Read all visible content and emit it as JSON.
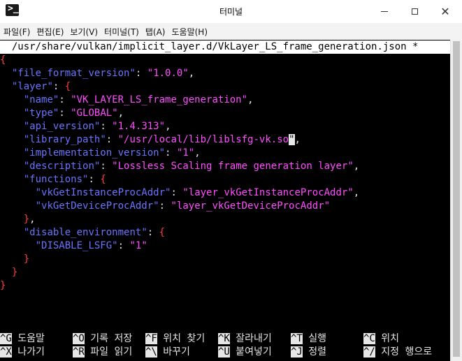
{
  "window": {
    "title": "터미널",
    "prompt_glyph": ">_",
    "close_glyph": "✕"
  },
  "menu": [
    "파일(F)",
    "편집(E)",
    "보기(V)",
    "터미널(T)",
    "탭(A)",
    "도움말(H)"
  ],
  "editor": {
    "header": "  /usr/share/vulkan/implicit_layer.d/VkLayer_LS_frame_generation.json *",
    "cursor_char": "\""
  },
  "json": {
    "open_brace": "{",
    "close_brace": "}",
    "file_format_version_key": "file_format_version",
    "file_format_version_value": "1.0.0",
    "layer_key": "layer",
    "name_key": "name",
    "name_value": "VK_LAYER_LS_frame_generation",
    "type_key": "type",
    "type_value": "GLOBAL",
    "api_version_key": "api_version",
    "api_version_value": "1.4.313",
    "library_path_key": "library_path",
    "library_path_value": "/usr/local/lib/liblsfg-vk.so",
    "implementation_version_key": "implementation_version",
    "implementation_version_value": "1",
    "description_key": "description",
    "description_value": "Lossless Scaling frame generation layer",
    "functions_key": "functions",
    "get_instance_key": "vkGetInstanceProcAddr",
    "get_instance_value": "layer_vkGetInstanceProcAddr",
    "get_device_key": "vkGetDeviceProcAddr",
    "get_device_value": "layer_vkGetDeviceProcAddr",
    "disable_env_key": "disable_environment",
    "disable_lsfg_key": "DISABLE_LSFG",
    "disable_lsfg_value": "1"
  },
  "shortcuts": {
    "row1": [
      {
        "key": "^G",
        "label": "도움말"
      },
      {
        "key": "^O",
        "label": "기록 저장"
      },
      {
        "key": "^F",
        "label": "위치 찾기"
      },
      {
        "key": "^K",
        "label": "잘라내기"
      },
      {
        "key": "^T",
        "label": "실행"
      },
      {
        "key": "^C",
        "label": "위치"
      }
    ],
    "row2": [
      {
        "key": "^X",
        "label": "나가기"
      },
      {
        "key": "^R",
        "label": "파일 읽기"
      },
      {
        "key": "^\\",
        "label": "바꾸기"
      },
      {
        "key": "^U",
        "label": "붙여넣기"
      },
      {
        "key": "^J",
        "label": "정렬"
      },
      {
        "key": "^/",
        "label": "지정 행으로"
      }
    ]
  },
  "colors": {
    "terminal_bg": "#000000",
    "brace": "#ff3c3c",
    "key": "#6a74ff",
    "string": "#ff4cff",
    "text": "#e6e6e6"
  }
}
